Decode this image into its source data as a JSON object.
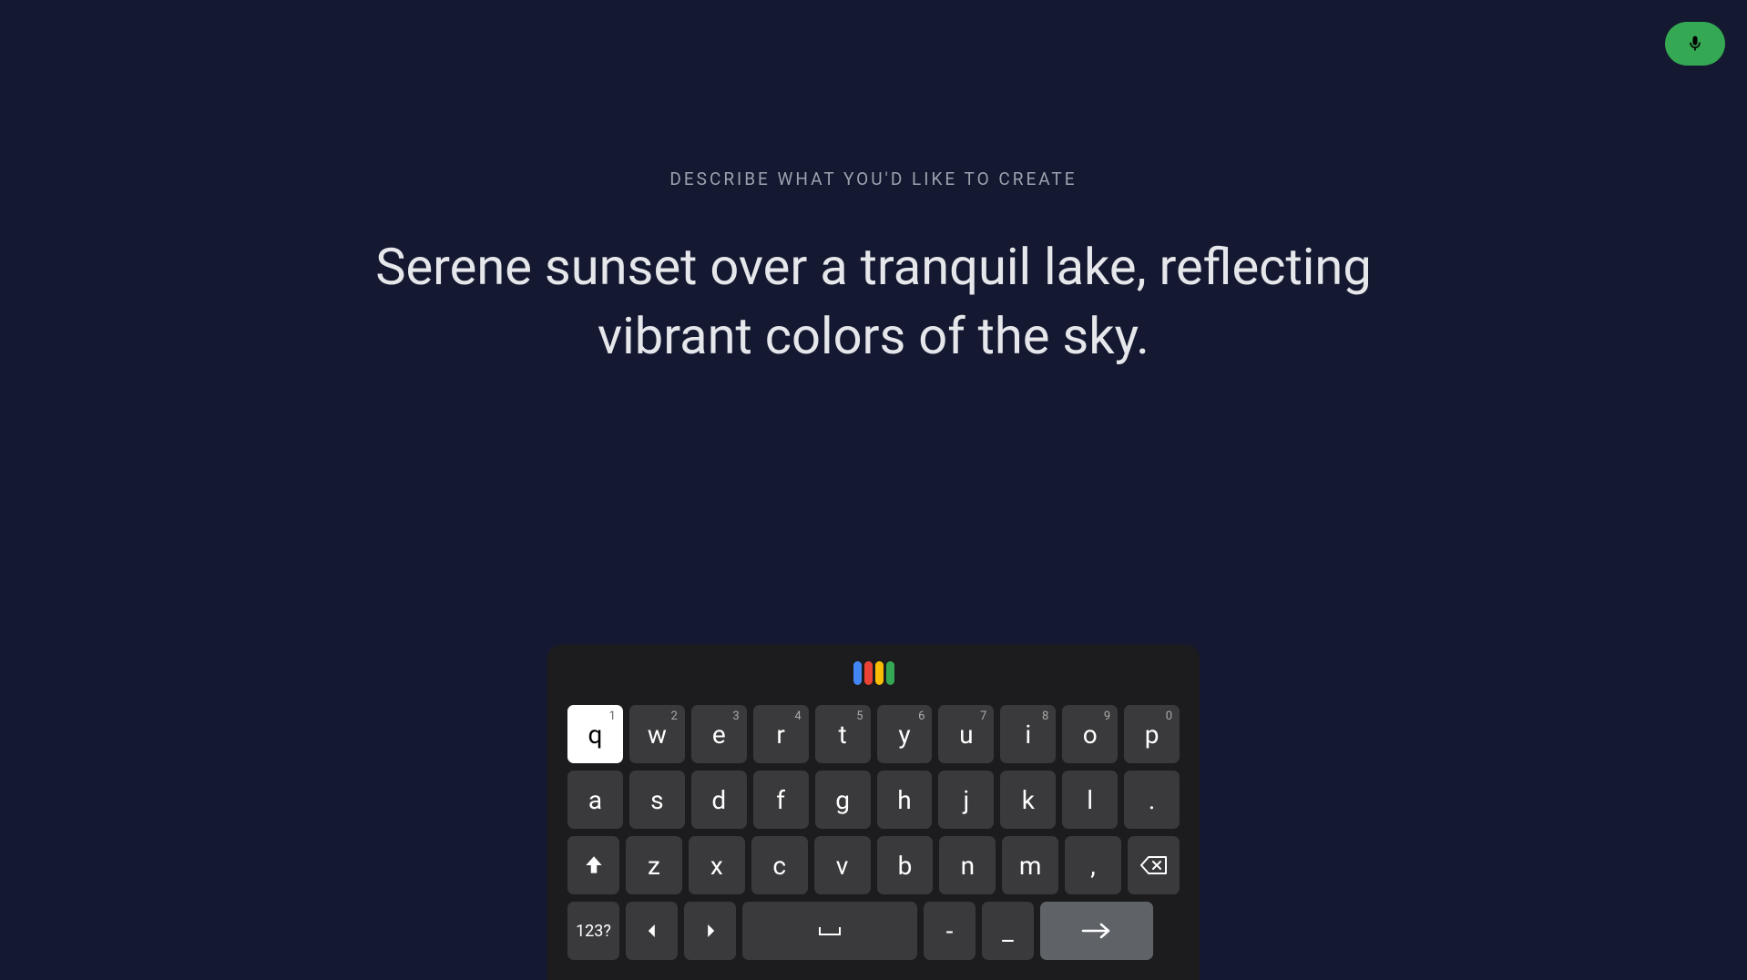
{
  "mic": {
    "name": "microphone"
  },
  "prompt": {
    "label": "DESCRIBE WHAT YOU'D LIKE TO CREATE",
    "text": "Serene sunset over a tranquil lake, reflecting vibrant colors of the sky."
  },
  "keyboard": {
    "row1": [
      {
        "k": "q",
        "n": "1",
        "active": true
      },
      {
        "k": "w",
        "n": "2"
      },
      {
        "k": "e",
        "n": "3"
      },
      {
        "k": "r",
        "n": "4"
      },
      {
        "k": "t",
        "n": "5"
      },
      {
        "k": "y",
        "n": "6"
      },
      {
        "k": "u",
        "n": "7"
      },
      {
        "k": "i",
        "n": "8"
      },
      {
        "k": "o",
        "n": "9"
      },
      {
        "k": "p",
        "n": "0"
      }
    ],
    "row2": [
      {
        "k": "a"
      },
      {
        "k": "s"
      },
      {
        "k": "d"
      },
      {
        "k": "f"
      },
      {
        "k": "g"
      },
      {
        "k": "h"
      },
      {
        "k": "j"
      },
      {
        "k": "k"
      },
      {
        "k": "l"
      },
      {
        "k": "."
      }
    ],
    "row3": [
      {
        "k": "z"
      },
      {
        "k": "x"
      },
      {
        "k": "c"
      },
      {
        "k": "v"
      },
      {
        "k": "b"
      },
      {
        "k": "n"
      },
      {
        "k": "m"
      },
      {
        "k": ","
      }
    ],
    "symbols_label": "123?",
    "hyphen": "-",
    "underscore": "_"
  }
}
